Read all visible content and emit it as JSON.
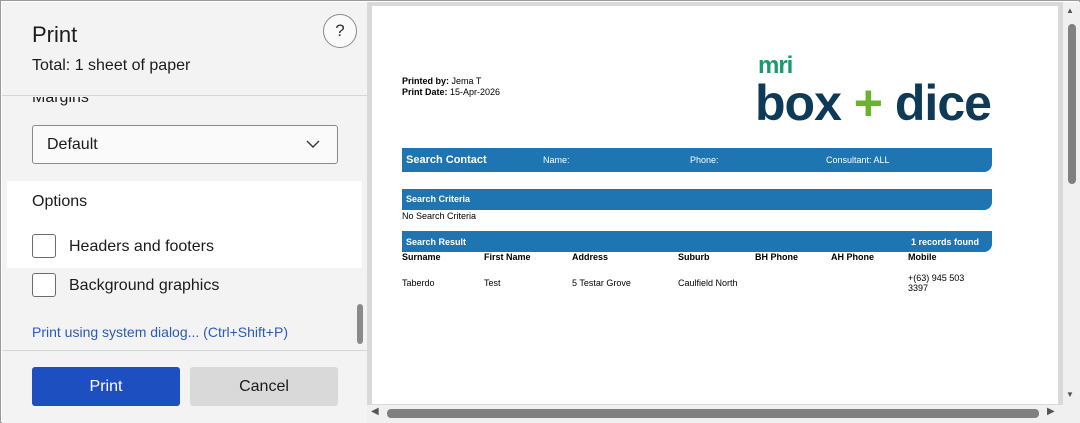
{
  "panel": {
    "title": "Print",
    "subtitle": "Total: 1 sheet of paper",
    "help_label": "?",
    "margins_label": "Margins",
    "margins_value": "Default",
    "options_label": "Options",
    "headers_footers_label": "Headers and footers",
    "background_graphics_label": "Background graphics",
    "system_dialog_link": "Print using system dialog... (Ctrl+Shift+P)",
    "print_button": "Print",
    "cancel_button": "Cancel"
  },
  "preview": {
    "printed_by_label": "Printed by:",
    "printed_by_value": "Jema T",
    "print_date_label": "Print Date:",
    "print_date_value": "15-Apr-2026",
    "logo_small": "mri",
    "logo_main_left": "box ",
    "logo_plus": "+",
    "logo_main_right": " dice",
    "search_contact": {
      "title": "Search Contact",
      "name_label": "Name:",
      "phone_label": "Phone:",
      "consultant_label": "Consultant: ALL"
    },
    "search_criteria": {
      "title": "Search Criteria",
      "value": "No Search Criteria"
    },
    "search_result": {
      "title": "Search Result",
      "count": "1 records found",
      "columns": [
        "Surname",
        "First Name",
        "Address",
        "Suburb",
        "BH Phone",
        "AH Phone",
        "Mobile"
      ],
      "rows": [
        [
          "Taberdo",
          "Test",
          "5 Testar Grove",
          "Caulfield North",
          "",
          "",
          "+(63)  945 503 3397"
        ]
      ]
    }
  },
  "colors": {
    "accent": "#1d4fc0",
    "header_bar": "#1f74b2",
    "logo_green": "#6ab42d",
    "logo_navy": "#0f3a57"
  }
}
